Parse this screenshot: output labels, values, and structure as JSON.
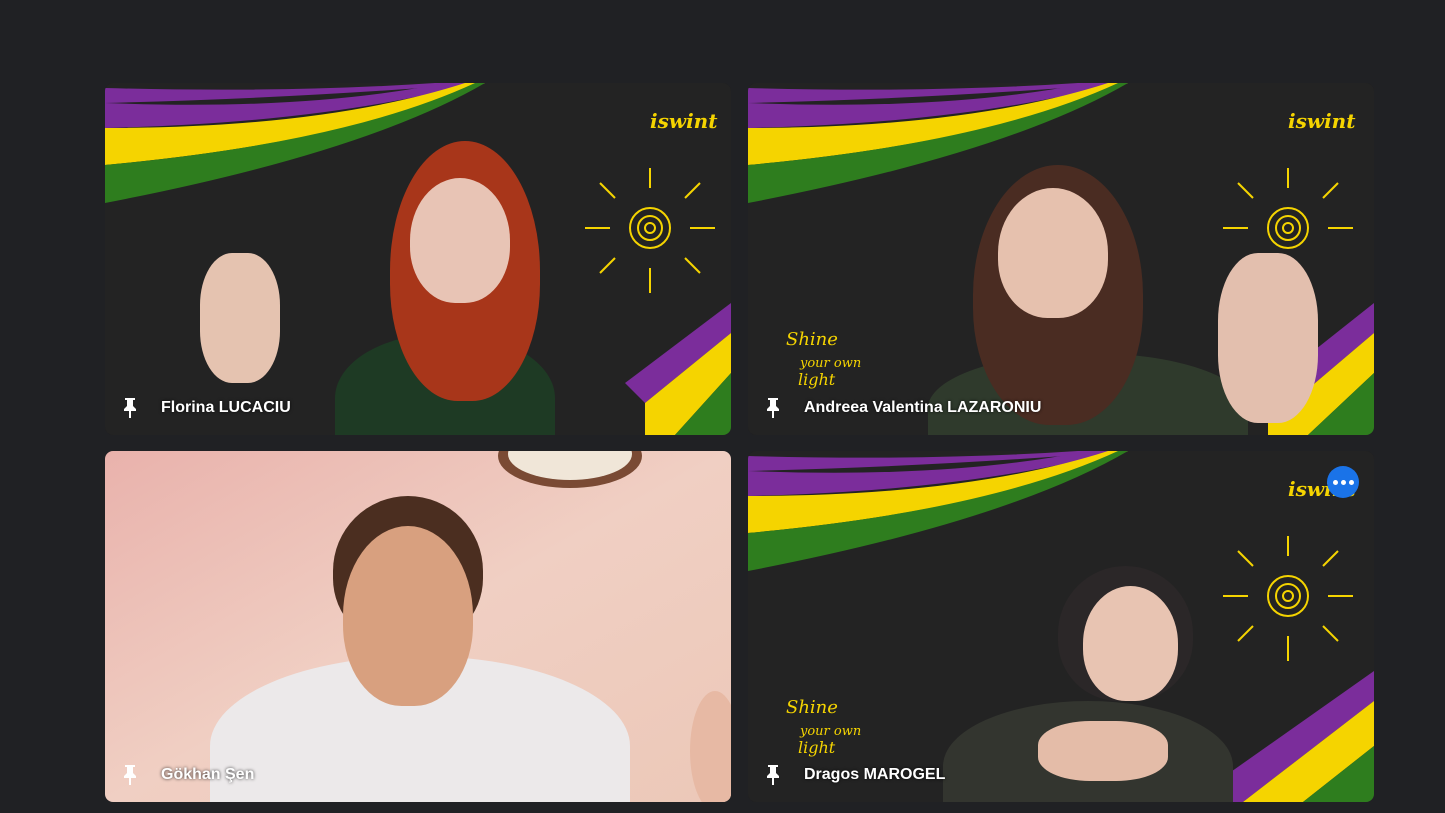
{
  "participants": [
    {
      "name": "Florina LUCACIU",
      "pinned_icon": "pin-icon",
      "background": "virtual-chalkboard"
    },
    {
      "name": "Andreea Valentina LAZARONIU",
      "pinned_icon": "pin-icon",
      "background": "virtual-chalkboard"
    },
    {
      "name": "Gökhan Şen",
      "pinned_icon": "pin-icon",
      "background": "room-wall"
    },
    {
      "name": "Dragos MAROGEL",
      "pinned_icon": "pin-icon",
      "background": "virtual-chalkboard",
      "more_options_icon": "more-horizontal-icon"
    }
  ],
  "colors": {
    "page_background": "#202124",
    "stripe_purple": "#7b2d9b",
    "stripe_yellow": "#f5d400",
    "stripe_green": "#2e7d1e",
    "accent_blue": "#1a73e8"
  }
}
